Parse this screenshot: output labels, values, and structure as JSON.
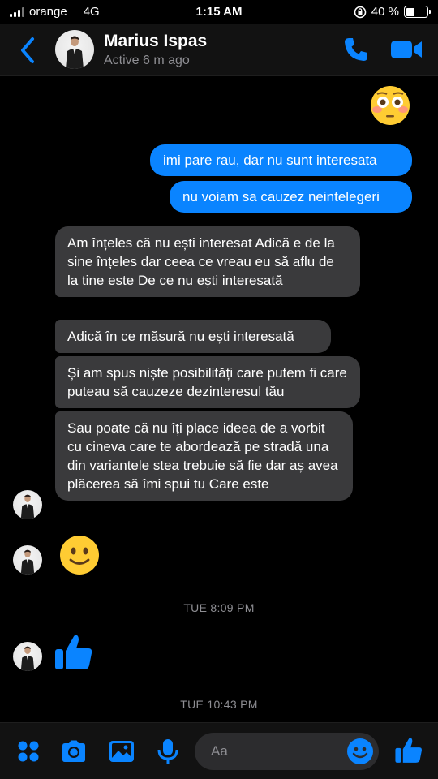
{
  "status_bar": {
    "carrier": "orange",
    "network": "4G",
    "time": "1:15 AM",
    "battery": "40 %",
    "battery_level": 0.4
  },
  "header": {
    "name": "Marius Ispas",
    "status": "Active 6 m ago"
  },
  "messages": {
    "sent_1": "imi pare rau, dar nu sunt interesata",
    "sent_2": "nu voiam sa cauzez neintelegeri",
    "recv_1": "Am înțeles că nu ești interesat Adică e de la sine înțeles dar ceea ce vreau eu să aflu de la tine este De ce nu ești interesată",
    "recv_2": "Adică în ce măsură nu ești interesată",
    "recv_3": "Și am spus niște posibilități care putem fi care puteau să cauzeze dezinteresul tău",
    "recv_4": "Sau poate că nu îți place ideea de a vorbit cu cineva care te abordează pe stradă una din variantele stea trebuie să fie dar aș avea plăcerea să îmi spui tu Care este"
  },
  "timestamps": {
    "first": "TUE 8:09 PM",
    "second": "TUE 10:43 PM"
  },
  "composer": {
    "placeholder": "Aa"
  },
  "colors": {
    "accent": "#0a84ff",
    "bubble_received": "#3a3a3c",
    "background": "#000000"
  }
}
